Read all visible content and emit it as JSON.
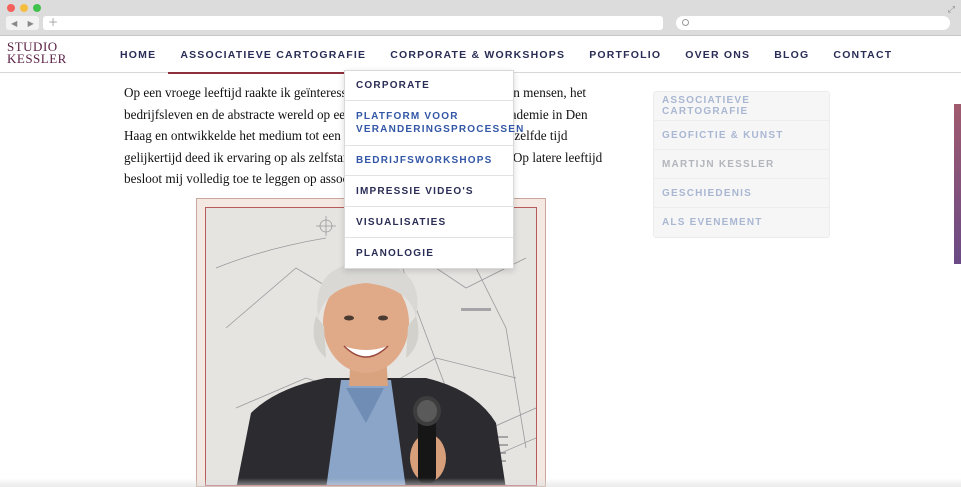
{
  "browser": {
    "back_label": "◀",
    "forward_label": "▶",
    "new_tab_label": "+",
    "url": "",
    "search_placeholder": ""
  },
  "site": {
    "logo_line1": "STUDIO",
    "logo_line2": "KESSLER",
    "brand_color": "#5a1f43",
    "accent_color": "#8d2f3c"
  },
  "nav": {
    "items": [
      {
        "label": "HOME"
      },
      {
        "label": "ASSOCIATIEVE CARTOGRAFIE",
        "active": true
      },
      {
        "label": "CORPORATE & WORKSHOPS"
      },
      {
        "label": "PORTFOLIO"
      },
      {
        "label": "OVER ONS"
      },
      {
        "label": "BLOG"
      },
      {
        "label": "CONTACT"
      }
    ]
  },
  "dropdown": {
    "items": [
      {
        "label": "CORPORATE"
      },
      {
        "label": "PLATFORM VOOR VERANDERINGSPROCESSEN",
        "highlight": true
      },
      {
        "label": "BEDRIJFSWORKSHOPS",
        "highlight": true
      },
      {
        "label": "IMPRESSIE VIDEO'S"
      },
      {
        "label": "VISUALISATIES"
      },
      {
        "label": "PLANOLOGIE"
      }
    ]
  },
  "main": {
    "intro_text": "Op een vroege leeftijd raakte ik geïnteresseerd in kaarten, plattegronden en mensen, het bedrijfsleven en de abstracte wereld op een wijze die me naar de Kunstacademie in Den Haag en ontwikkelde het medium tot een kunstvorm. Gaandeweg en in dezelfde tijd gelijkertijd deed ik ervaring op als zelfstandig ondernemer in de praktijk. Op latere leeftijd besloot mij volledig toe te leggen op associatieve cartografie en...",
    "photo_alt": "Martijn Kessler"
  },
  "sidebar": {
    "items": [
      {
        "label": "ASSOCIATIEVE CARTOGRAFIE"
      },
      {
        "label": "GEOFICTIE & KUNST"
      },
      {
        "label": "MARTIJN KESSLER",
        "current": true
      },
      {
        "label": "GESCHIEDENIS"
      },
      {
        "label": "ALS EVENEMENT"
      }
    ]
  }
}
